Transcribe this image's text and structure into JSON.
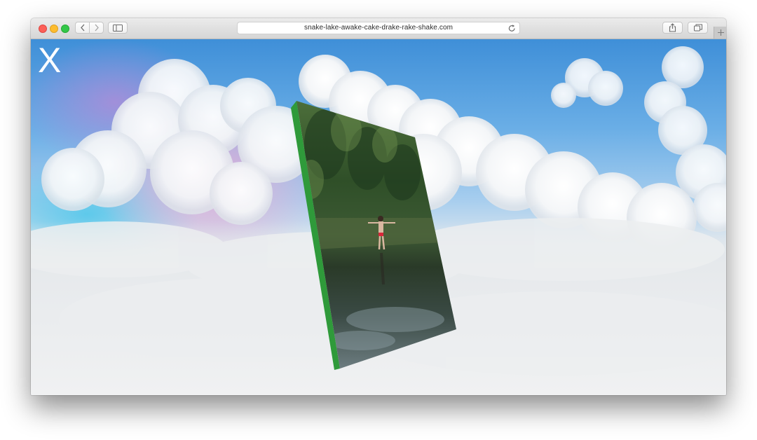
{
  "browser": {
    "url": "snake-lake-awake-cake-drake-rake-shake.com",
    "buttons": {
      "back_icon": "chevron-left-icon",
      "forward_icon": "chevron-right-icon",
      "sidebar_icon": "sidebar-icon",
      "share_icon": "share-icon",
      "tabs_icon": "tabs-overview-icon",
      "new_tab_icon": "plus-icon",
      "reload_icon": "reload-icon"
    }
  },
  "page": {
    "close_label": "X",
    "panel_edge_color": "#2f9a3a",
    "sky_color": "#4d9be0"
  }
}
